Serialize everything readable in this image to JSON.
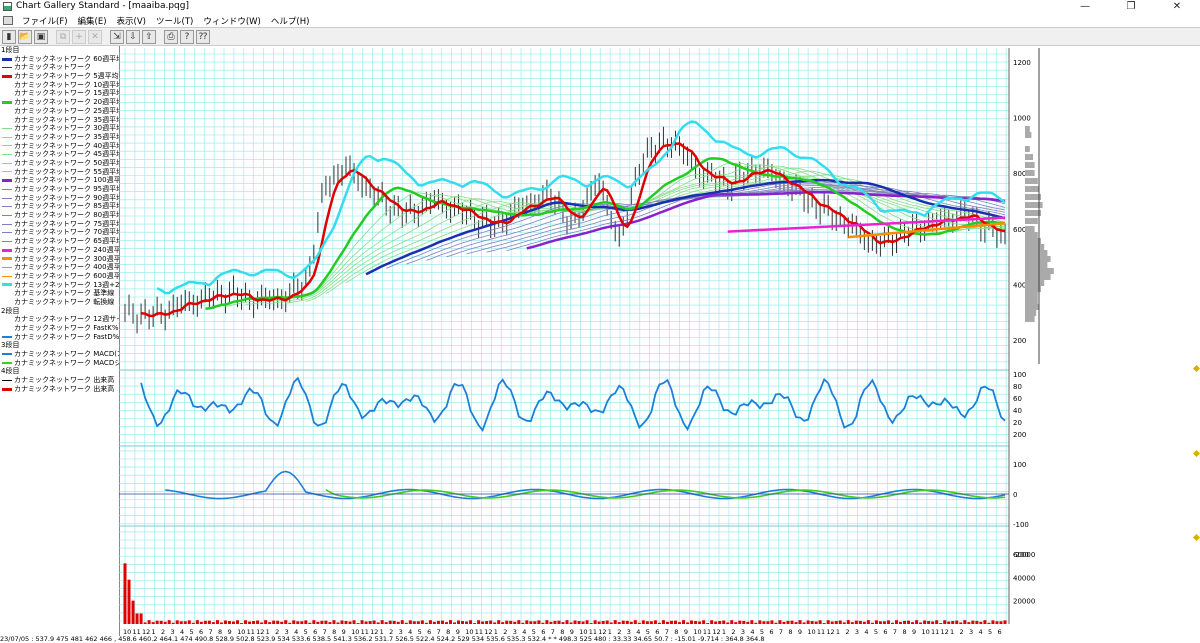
{
  "window": {
    "title": "Chart Gallery Standard - [maaiba.pqg]",
    "minimize": "—",
    "maximize": "❐",
    "close": "✕"
  },
  "menu": [
    "ファイル(F)",
    "編集(E)",
    "表示(V)",
    "ツール(T)",
    "ウィンドウ(W)",
    "ヘルプ(H)"
  ],
  "toolbar": [
    {
      "name": "new-chart",
      "glyph": "▮",
      "enabled": true
    },
    {
      "name": "open",
      "glyph": "📂",
      "enabled": true
    },
    {
      "name": "save",
      "glyph": "▣",
      "enabled": true
    },
    {
      "name": "sep"
    },
    {
      "name": "copy",
      "glyph": "⧉",
      "enabled": false
    },
    {
      "name": "add",
      "glyph": "+",
      "enabled": false
    },
    {
      "name": "delete",
      "glyph": "✕",
      "enabled": false
    },
    {
      "name": "sep"
    },
    {
      "name": "tool-a",
      "glyph": "⇲",
      "enabled": true
    },
    {
      "name": "tool-b",
      "glyph": "⇩",
      "enabled": true
    },
    {
      "name": "tool-c",
      "glyph": "⇧",
      "enabled": true
    },
    {
      "name": "sep"
    },
    {
      "name": "print",
      "glyph": "⎙",
      "enabled": true
    },
    {
      "name": "help",
      "glyph": "?",
      "enabled": true
    },
    {
      "name": "context-help",
      "glyph": "⁇",
      "enabled": true
    }
  ],
  "legend": [
    {
      "type": "header",
      "text": "1段目"
    },
    {
      "text": "カナミックネットワーク 60週平均",
      "color": "#1a2fb0",
      "w": 3
    },
    {
      "text": "カナミックネットワーク",
      "color": "#3a3a3a",
      "w": 1
    },
    {
      "text": "カナミックネットワーク 5週平均",
      "color": "#e00000",
      "w": 3
    },
    {
      "text": "カナミックネットワーク 10週平均",
      "color": "",
      "w": 0
    },
    {
      "text": "カナミックネットワーク 15週平均",
      "color": "",
      "w": 0
    },
    {
      "text": "カナミックネットワーク 20週平均",
      "color": "#22cc22",
      "w": 3
    },
    {
      "text": "カナミックネットワーク 25週平均",
      "color": "",
      "w": 0
    },
    {
      "text": "カナミックネットワーク 35週平均",
      "color": "",
      "w": 0
    },
    {
      "text": "カナミックネットワーク 30週平均",
      "color": "#88dd88",
      "w": 1
    },
    {
      "text": "カナミックネットワーク 35週平均",
      "color": "#88dd88",
      "w": 1
    },
    {
      "text": "カナミックネットワーク 40週平均",
      "color": "#88dd88",
      "w": 1
    },
    {
      "text": "カナミックネットワーク 45週平均",
      "color": "#88dd88",
      "w": 1
    },
    {
      "text": "カナミックネットワーク 50週平均",
      "color": "#88dd88",
      "w": 1
    },
    {
      "text": "カナミックネットワーク 55週平均",
      "color": "#88dd88",
      "w": 1
    },
    {
      "text": "カナミックネットワーク 100週平均",
      "color": "#8822cc",
      "w": 3
    },
    {
      "text": "カナミックネットワーク 95週平均",
      "color": "#8080c0",
      "w": 1
    },
    {
      "text": "カナミックネットワーク 90週平均",
      "color": "#8080c0",
      "w": 1
    },
    {
      "text": "カナミックネットワーク 85週平均",
      "color": "#8080c0",
      "w": 1
    },
    {
      "text": "カナミックネットワーク 80週平均",
      "color": "#8080c0",
      "w": 1
    },
    {
      "text": "カナミックネットワーク 75週平均",
      "color": "#8080c0",
      "w": 1
    },
    {
      "text": "カナミックネットワーク 70週平均",
      "color": "#8080c0",
      "w": 1
    },
    {
      "text": "カナミックネットワーク 65週平均",
      "color": "#8080c0",
      "w": 1
    },
    {
      "text": "カナミックネットワーク 240週平均",
      "color": "#ee22cc",
      "w": 3
    },
    {
      "text": "カナミックネットワーク 300週平均",
      "color": "#ff8c00",
      "w": 3
    },
    {
      "text": "カナミックネットワーク 400週平均",
      "color": "#ff8c00",
      "w": 1
    },
    {
      "text": "カナミックネットワーク 600週平均",
      "color": "#ff8c00",
      "w": 1
    },
    {
      "text": "カナミックネットワーク 13週+2σ",
      "color": "#33ddee",
      "w": 3
    },
    {
      "text": "カナミックネットワーク 基準線",
      "color": "",
      "w": 0
    },
    {
      "text": "カナミックネットワーク 転換線",
      "color": "",
      "w": 0
    },
    {
      "type": "header",
      "text": "2段目"
    },
    {
      "text": "カナミックネットワーク 12週サイコロ",
      "color": "",
      "w": 0
    },
    {
      "text": "カナミックネットワーク FastK%",
      "color": "",
      "w": 0
    },
    {
      "text": "カナミックネットワーク FastD%",
      "color": "#1f7fd8",
      "w": 2
    },
    {
      "type": "header",
      "text": "3段目"
    },
    {
      "text": "カナミックネットワーク MACD(10",
      "color": "#1f7fd8",
      "w": 2
    },
    {
      "text": "カナミックネットワーク MACDシグ",
      "color": "#44cc22",
      "w": 2
    },
    {
      "type": "header",
      "text": "4段目"
    },
    {
      "text": "カナミックネットワーク 出来高",
      "color": "#000000",
      "w": 1
    },
    {
      "text": "カナミックネットワーク 出来高",
      "color": "#e00000",
      "w": 3
    }
  ],
  "axes": {
    "price_ticks": [
      "1200",
      "1000",
      "800",
      "600",
      "400",
      "200"
    ],
    "stoch_ticks": [
      "100",
      "80",
      "60",
      "40",
      "20"
    ],
    "macd_ticks": [
      "200",
      "100",
      "0",
      "-100",
      "-200"
    ],
    "volume_ticks": [
      "60000",
      "40000",
      "20000"
    ]
  },
  "date_labels": [
    "10",
    "11",
    "12",
    "1",
    "2",
    "3",
    "4",
    "5",
    "6",
    "7",
    "8",
    "9",
    "10",
    "11",
    "12",
    "1",
    "2",
    "3",
    "4",
    "5",
    "6",
    "7",
    "8",
    "9",
    "10",
    "11",
    "12",
    "1",
    "2",
    "3",
    "4",
    "5",
    "6",
    "7",
    "8",
    "9",
    "10",
    "11",
    "12",
    "1",
    "2",
    "3",
    "4",
    "5",
    "6",
    "7",
    "8",
    "9",
    "10",
    "11",
    "12",
    "1",
    "2",
    "3",
    "4",
    "5",
    "6",
    "7",
    "8",
    "9",
    "10",
    "11",
    "12",
    "1",
    "2",
    "3",
    "4",
    "5",
    "6",
    "7",
    "8",
    "9",
    "10",
    "11",
    "12",
    "1",
    "2",
    "3",
    "4",
    "5",
    "6",
    "7",
    "8",
    "9",
    "10",
    "11",
    "12",
    "1",
    "2",
    "3",
    "4",
    "5",
    "6"
  ],
  "status": "23/07/05 : 537.9 475 481 462 466 , 458.6 460.2 464.1 474 490.8 528.9 502.8 523.9 534 533.6 538.5 541.3 536.2 531.7 526.5 522.4 524.2 529 534 535.6 535.3 532.4 * * 498.3 525 480 : 33.33 34.65 50.7 : -15.01 -9.714 : 364.8 364.8",
  "colors": {
    "grid": "#8ee8ee",
    "price": "#333333",
    "ma60": "#1a2fb0",
    "ma5": "#e00000",
    "ma20": "#22cc22",
    "ma100": "#8822cc",
    "ma240": "#ee22cc",
    "ma300": "#ff8c00",
    "band": "#33ddee",
    "stoch": "#1f7fd8",
    "macd": "#1f7fd8",
    "macd_signal": "#44cc22",
    "volume": "#e00000"
  }
}
